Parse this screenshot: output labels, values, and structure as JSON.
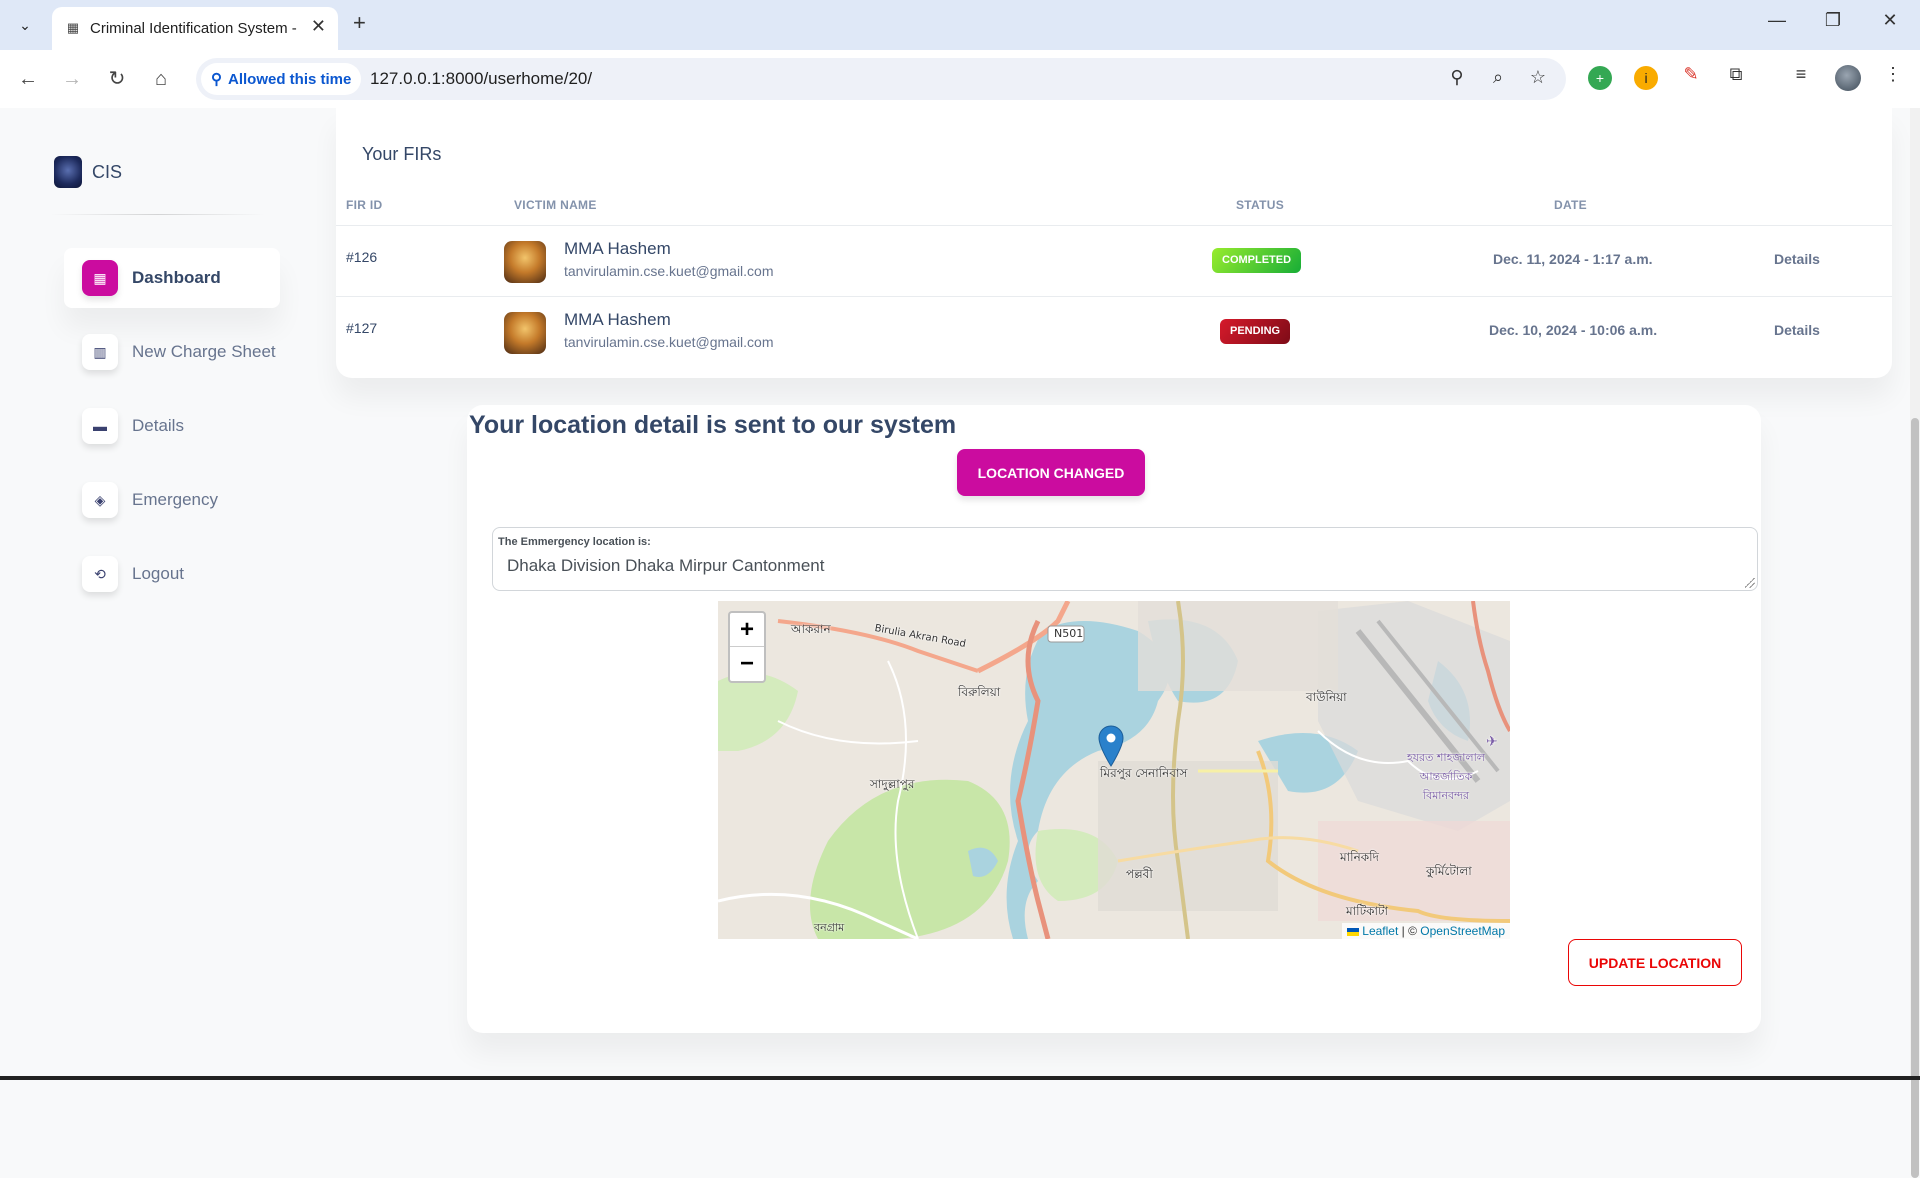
{
  "browser": {
    "tab_title": "Criminal Identification System -",
    "site_permission": "Allowed this time",
    "url": "127.0.0.1:8000/userhome/20/"
  },
  "sidebar": {
    "brand": "CIS",
    "items": [
      {
        "label": "Dashboard",
        "icon": "shop-icon",
        "active": true
      },
      {
        "label": "New Charge Sheet",
        "icon": "office-icon"
      },
      {
        "label": "Details",
        "icon": "credit-card-icon"
      },
      {
        "label": "Emergency",
        "icon": "box-icon"
      },
      {
        "label": "Logout",
        "icon": "logout-icon"
      }
    ]
  },
  "firs": {
    "title": "Your FIRs",
    "columns": [
      "FIR ID",
      "VICTIM NAME",
      "STATUS",
      "DATE"
    ],
    "rows": [
      {
        "id": "#126",
        "name": "MMA Hashem",
        "email": "tanvirulamin.cse.kuet@gmail.com",
        "status": "COMPLETED",
        "date": "Dec. 11, 2024 - 1:17 a.m.",
        "action": "Details"
      },
      {
        "id": "#127",
        "name": "MMA Hashem",
        "email": "tanvirulamin.cse.kuet@gmail.com",
        "status": "PENDING",
        "date": "Dec. 10, 2024 - 10:06 a.m.",
        "action": "Details"
      }
    ]
  },
  "location": {
    "heading": "Your location detail is sent to our system",
    "changed_button": "LOCATION CHANGED",
    "field_label": "The Emmergency location is:",
    "field_value": "Dhaka Division Dhaka Mirpur Cantonment",
    "update_button": "UPDATE LOCATION",
    "map": {
      "zoom_in": "+",
      "zoom_out": "−",
      "attribution_leaflet": "Leaflet",
      "attribution_sep": " | © ",
      "attribution_osm": "OpenStreetMap",
      "labels": {
        "akran": "আকরান",
        "birulia_road": "Birulia Akran Road",
        "n501": "N501",
        "birulia": "বিরুলিয়া",
        "baunia": "বাউনিয়া",
        "airport": "হযরত শাহজালাল আন্তর্জাতিক বিমানবন্দর",
        "sadullapur": "সাদুল্লাপুর",
        "mirpur_cantonment": "মিরপুর সেনানিবাস",
        "pallabi": "পল্লবী",
        "manikdi": "মানিকদি",
        "kurmitola": "কুর্মিটোলা",
        "matikata": "মাটিকাটা",
        "bongram": "বনগ্রাম"
      }
    }
  },
  "colors": {
    "primary": "#cb0c9f",
    "danger": "#ea0606",
    "text": "#344767",
    "muted": "#67748e"
  }
}
